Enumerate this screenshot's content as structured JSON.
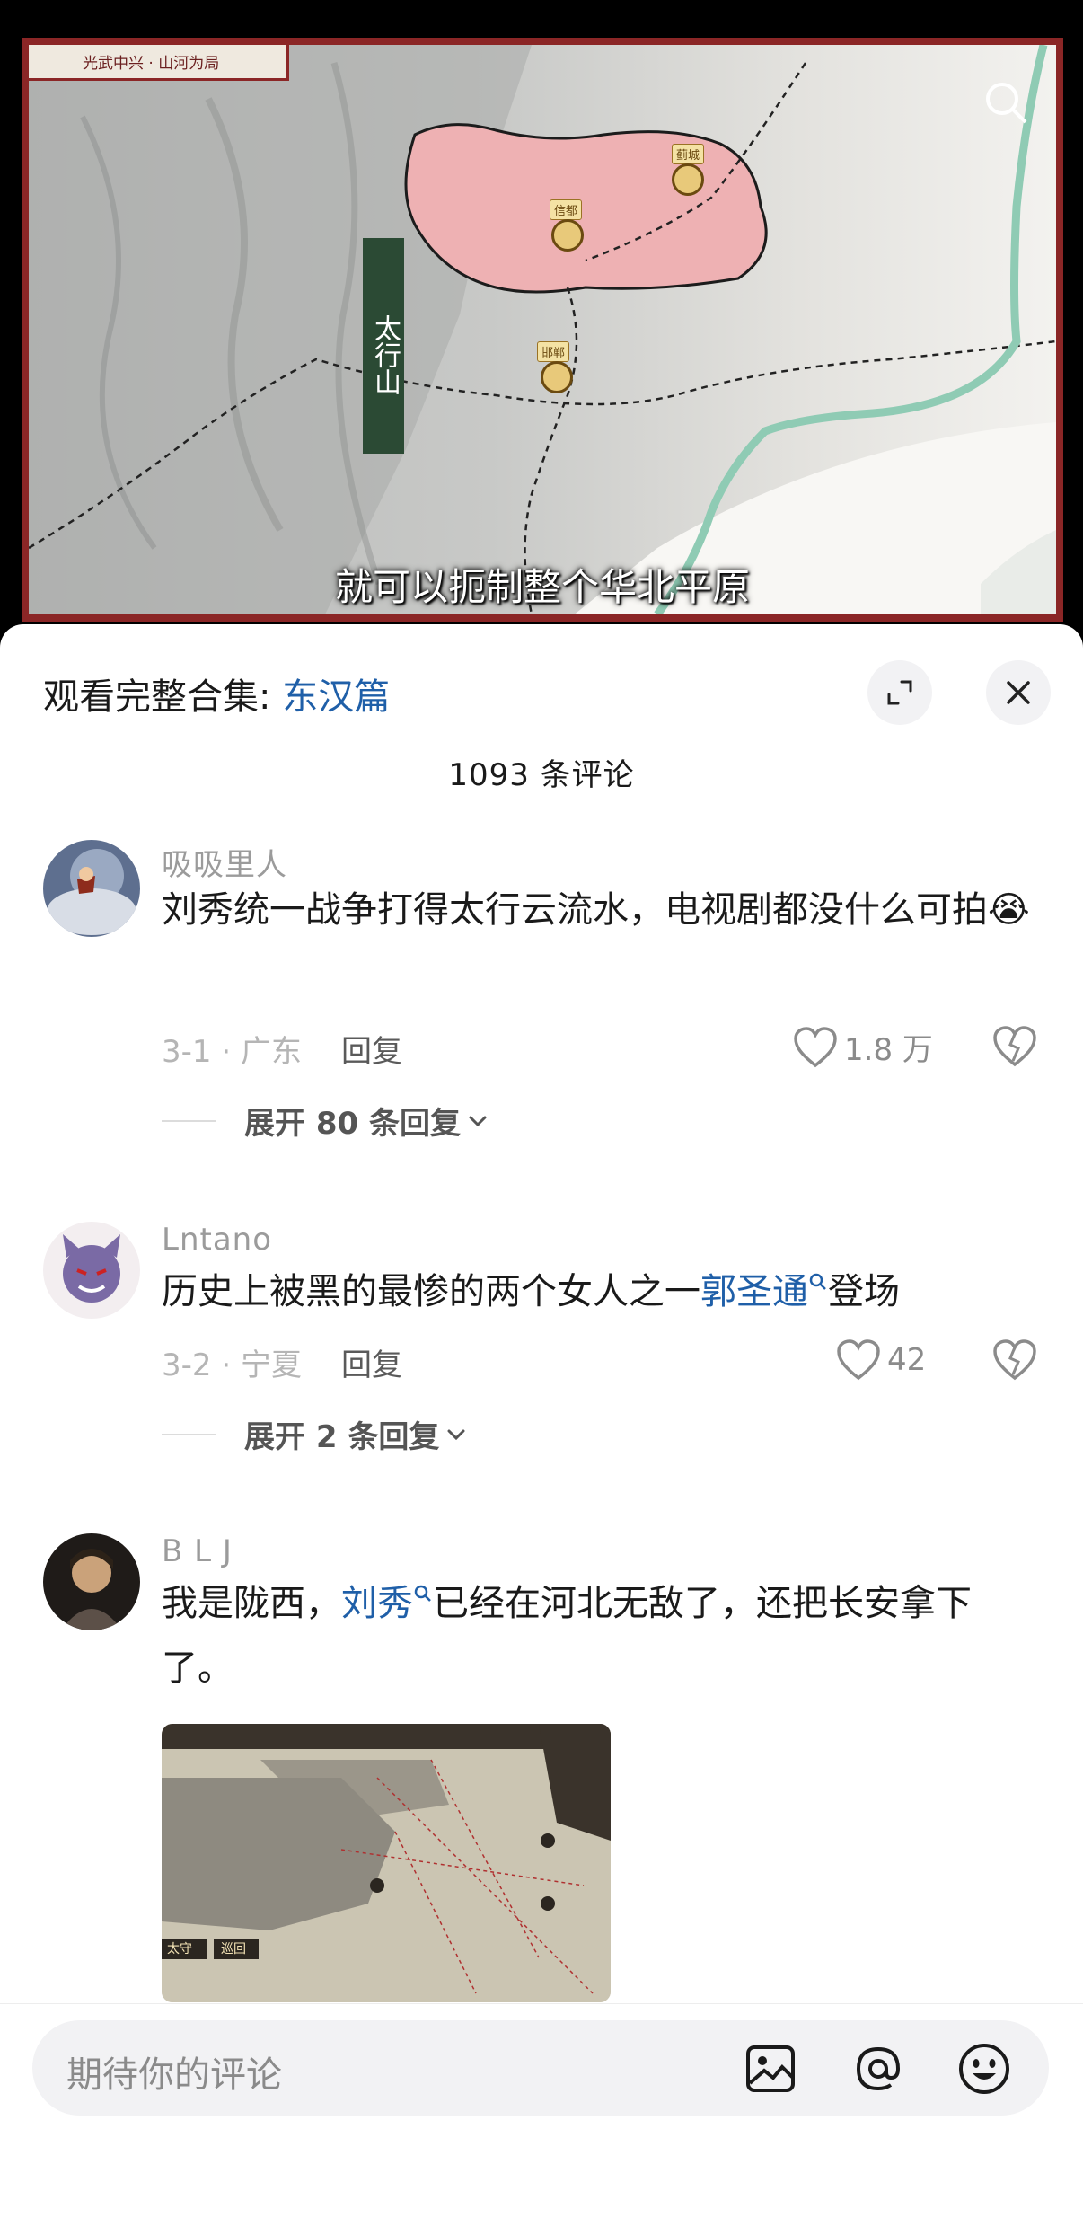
{
  "video": {
    "map_title": "光武中兴 · 山河为局",
    "mountain_label": "太行山",
    "city_tags": [
      "蓟城",
      "信都",
      "邯郸"
    ],
    "subtitle": "就可以扼制整个华北平原"
  },
  "sheet": {
    "collection_prefix": "观看完整合集: ",
    "collection_link": "东汉篇",
    "comment_count": "1093 条评论"
  },
  "comments": [
    {
      "username": "吸吸里人",
      "text": "刘秀统一战争打得太行云流水，电视剧都没什么可拍",
      "emoji": "😭",
      "date_location": "3-1 · 广东",
      "reply_label": "回复",
      "likes": "1.8 万",
      "expand_label": "展开 80 条回复"
    },
    {
      "username": "Lntano",
      "text_before": "历史上被黑的最惨的两个女人之一",
      "link": "郭圣通",
      "text_after": "登场",
      "date_location": "3-2 · 宁夏",
      "reply_label": "回复",
      "likes": "42",
      "expand_label": "展开 2 条回复"
    },
    {
      "username": "B L J",
      "text_before": "我是陇西，",
      "link": "刘秀",
      "text_after": "已经在河北无敌了，还把长安拿下了。",
      "game_labels": [
        "太守",
        "巡回"
      ]
    }
  ],
  "input": {
    "placeholder": "期待你的评论"
  },
  "colors": {
    "link": "#1f5fa8",
    "frame": "#8b2626",
    "region_fill": "#eeb1b3"
  },
  "icons": [
    "expand-icon",
    "close-icon",
    "heart-icon",
    "broken-heart-icon",
    "chevron-down-icon",
    "search-icon",
    "image-icon",
    "at-icon",
    "emoji-icon"
  ]
}
